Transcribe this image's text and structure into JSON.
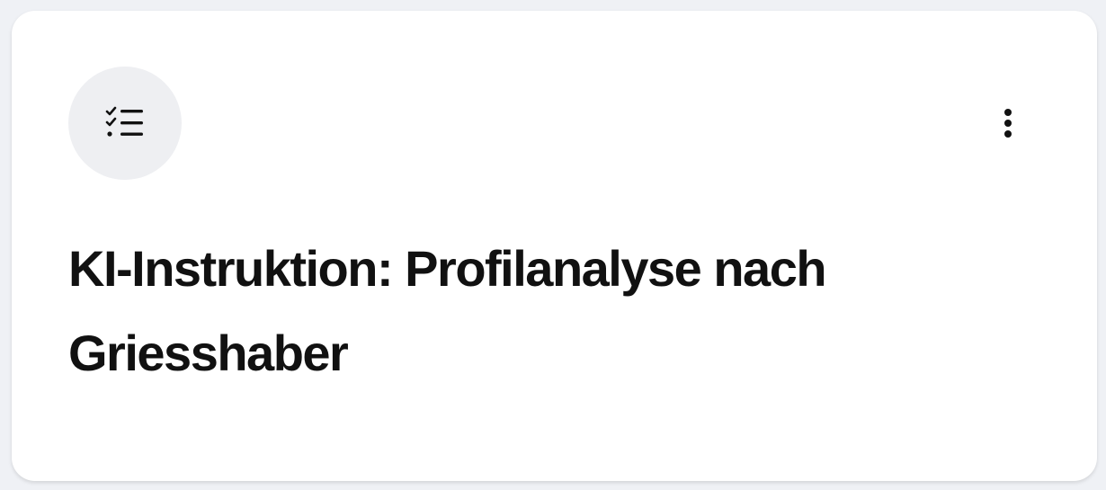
{
  "card": {
    "icon": "checklist-icon",
    "menu_icon": "more-vertical-icon",
    "title": "KI-Instruktion: Profilanalyse nach Griesshaber"
  },
  "colors": {
    "background": "#eff1f5",
    "card": "#ffffff",
    "icon_circle": "#eeeff2",
    "text": "#111111"
  }
}
